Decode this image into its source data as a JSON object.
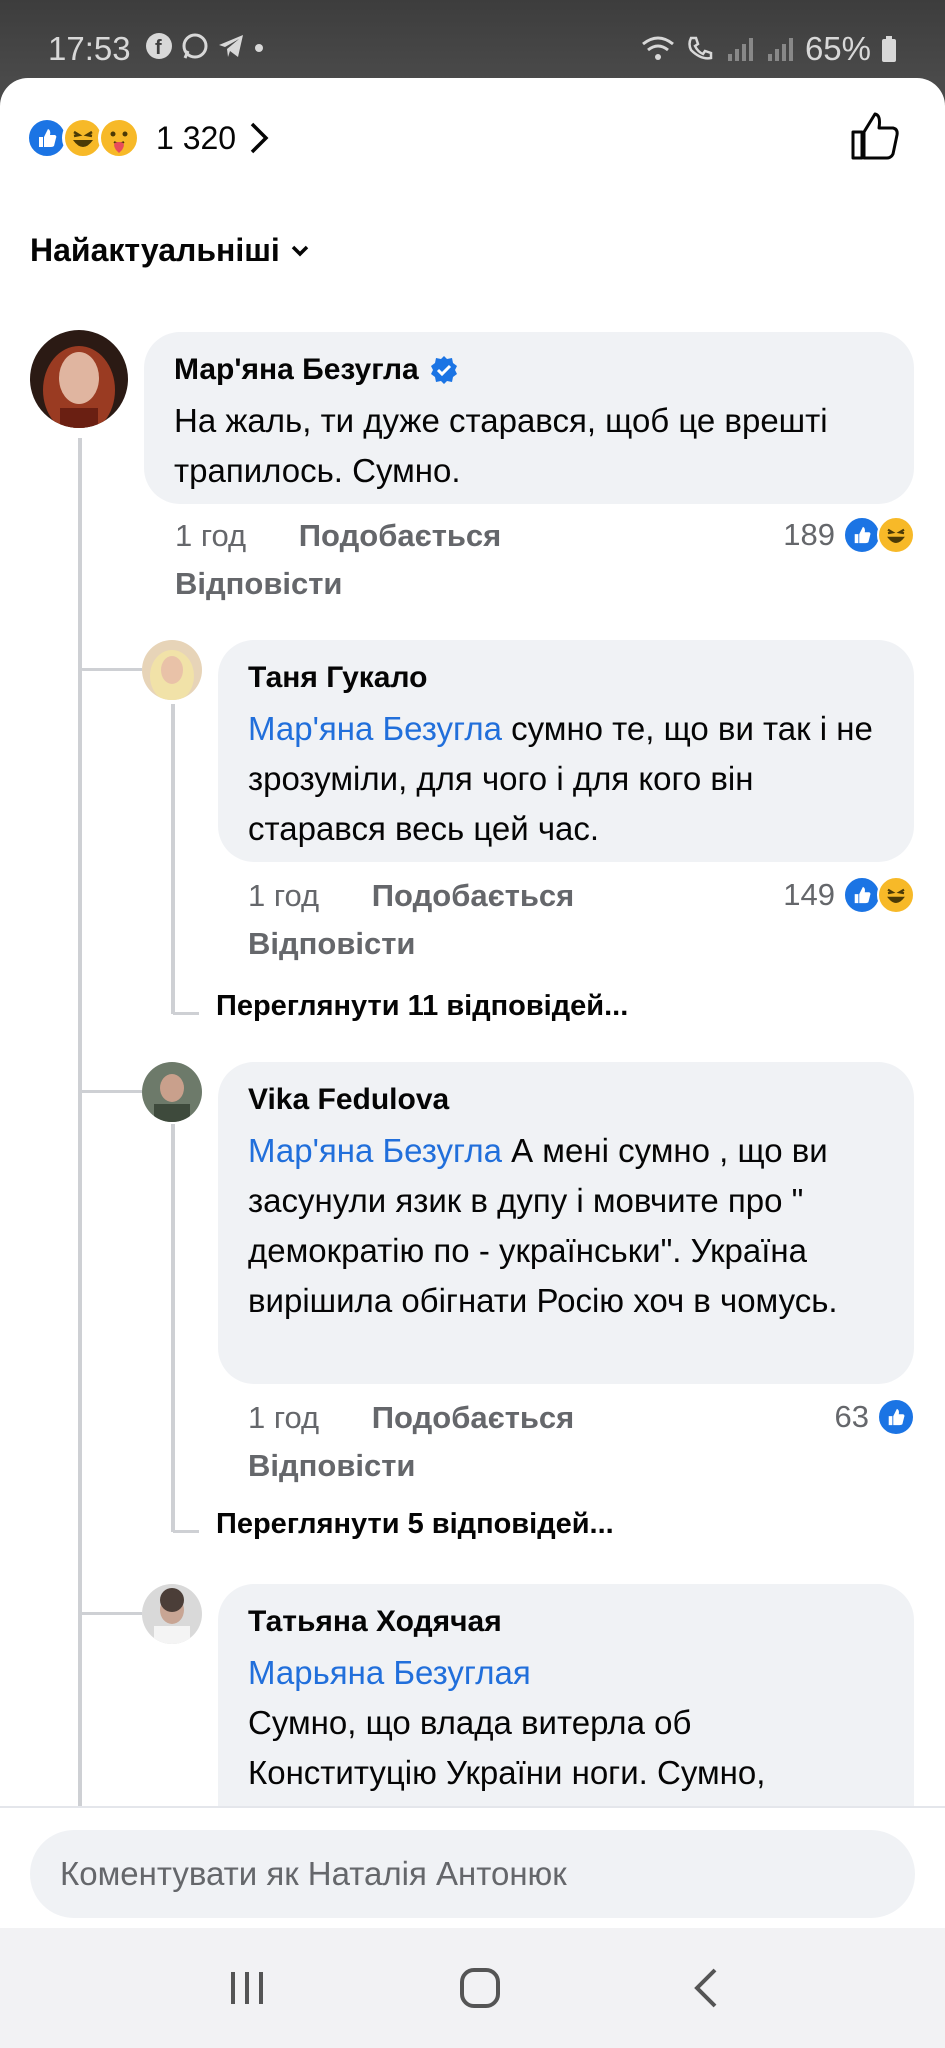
{
  "status_bar": {
    "time": "17:53",
    "battery": "65%"
  },
  "reactions": {
    "count": "1 320"
  },
  "sort": {
    "label": "Найактуальніші"
  },
  "comments": [
    {
      "author": "Мар'яна Безугла",
      "verified": true,
      "text": "На жаль, ти дуже старався, щоб це врешті трапилось. Сумно.",
      "time": "1 год",
      "like": "Подобається",
      "reply": "Відповісти",
      "count": "189"
    },
    {
      "author": "Таня Гукало",
      "mention": "Мар'яна Безугла",
      "text": " сумно те, що ви так і не зрозуміли, для чого і для кого він старався весь цей час.",
      "time": "1 год",
      "like": "Подобається",
      "reply": "Відповісти",
      "count": "149",
      "view_replies": "Переглянути 11 відповідей..."
    },
    {
      "author": "Vika Fedulova",
      "mention": "Мар'яна Безугла",
      "text": " А мені сумно , що ви засунули язик в дупу і мовчите про \" демократію по - українськи\".  Україна вирішила обігнати Росію хоч в чомусь.",
      "time": "1 год",
      "like": "Подобається",
      "reply": "Відповісти",
      "count": "63",
      "view_replies": "Переглянути 5 відповідей..."
    },
    {
      "author": "Татьяна Ходячая",
      "mention": "Марьяна Безуглая",
      "text": "Сумно, що влада витерла об Конституцію України ноги. Сумно,"
    }
  ],
  "composer": {
    "placeholder": "Коментувати як Наталія Антонюк"
  },
  "colors": {
    "accent": "#1b74e4",
    "mention": "#216fdb",
    "bubble": "#f0f2f5",
    "meta": "#65676b"
  }
}
